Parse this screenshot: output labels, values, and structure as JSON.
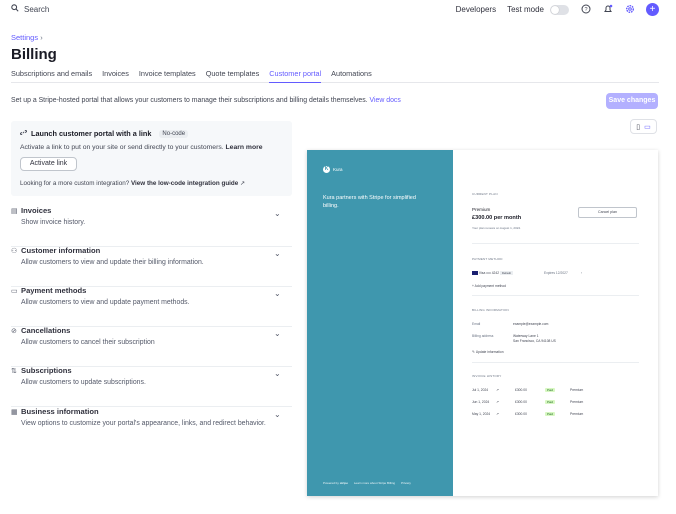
{
  "topbar": {
    "search_placeholder": "Search",
    "developers": "Developers",
    "test_mode": "Test mode"
  },
  "breadcrumb": "Settings",
  "page_title": "Billing",
  "tabs": [
    {
      "label": "Subscriptions and emails",
      "active": false
    },
    {
      "label": "Invoices",
      "active": false
    },
    {
      "label": "Invoice templates",
      "active": false
    },
    {
      "label": "Quote templates",
      "active": false
    },
    {
      "label": "Customer portal",
      "active": true
    },
    {
      "label": "Automations",
      "active": false
    }
  ],
  "intro": {
    "text": "Set up a Stripe-hosted portal that allows your customers to manage their subscriptions and billing details themselves.",
    "link": "View docs"
  },
  "save_button": "Save changes",
  "launch": {
    "title": "Launch customer portal with a link",
    "badge": "No-code",
    "description": "Activate a link to put on your site or send directly to your customers.",
    "learn_more": "Learn more",
    "activate_button": "Activate link",
    "footer_text": "Looking for a more custom integration?",
    "footer_link": "View the low-code integration guide"
  },
  "sections": [
    {
      "title": "Invoices",
      "subtitle": "Show invoice history.",
      "icon": "invoice-icon"
    },
    {
      "title": "Customer information",
      "subtitle": "Allow customers to view and update their billing information.",
      "icon": "person-icon"
    },
    {
      "title": "Payment methods",
      "subtitle": "Allow customers to view and update payment methods.",
      "icon": "card-icon"
    },
    {
      "title": "Cancellations",
      "subtitle": "Allow customers to cancel their subscription",
      "icon": "cancel-icon"
    },
    {
      "title": "Subscriptions",
      "subtitle": "Allow customers to update subscriptions.",
      "icon": "swap-icon"
    },
    {
      "title": "Business information",
      "subtitle": "View options to customize your portal's appearance, links, and redirect behavior.",
      "icon": "building-icon"
    }
  ],
  "preview": {
    "brand": "Kura",
    "tagline": "Kura partners with Stripe for simplified billing.",
    "footer_powered": "Powered by",
    "footer_stripe": "stripe",
    "footer_learn": "Learn more about Stripe Billing",
    "footer_privacy": "Privacy",
    "current_plan_heading": "CURRENT PLAN",
    "plan_name": "Premium",
    "plan_price": "£300.00 per month",
    "plan_renew": "Your plan renews on August 1, 2024.",
    "cancel_plan": "Cancel plan",
    "payment_heading": "PAYMENT METHOD",
    "card": "Visa •••• 4242",
    "card_badge": "Default",
    "card_expires": "Expires 12/2027",
    "add_payment": "+ Add payment method",
    "billing_heading": "BILLING INFORMATION",
    "email_label": "Email",
    "email_value": "example@example.com",
    "address_label": "Billing address",
    "address_line1": "Waterway Lane 1",
    "address_line2": "San Francisco, CA 94108 US",
    "update_info": "Update information",
    "history_heading": "INVOICE HISTORY",
    "invoices": [
      {
        "date": "Jul 1, 2024",
        "amount": "£300.00",
        "status": "Paid",
        "plan": "Premium"
      },
      {
        "date": "Jun 1, 2024",
        "amount": "£300.00",
        "status": "Paid",
        "plan": "Premium"
      },
      {
        "date": "May 1, 2024",
        "amount": "£300.00",
        "status": "Paid",
        "plan": "Premium"
      }
    ]
  },
  "colors": {
    "accent": "#635bff",
    "brand_panel": "#3f97ae"
  }
}
